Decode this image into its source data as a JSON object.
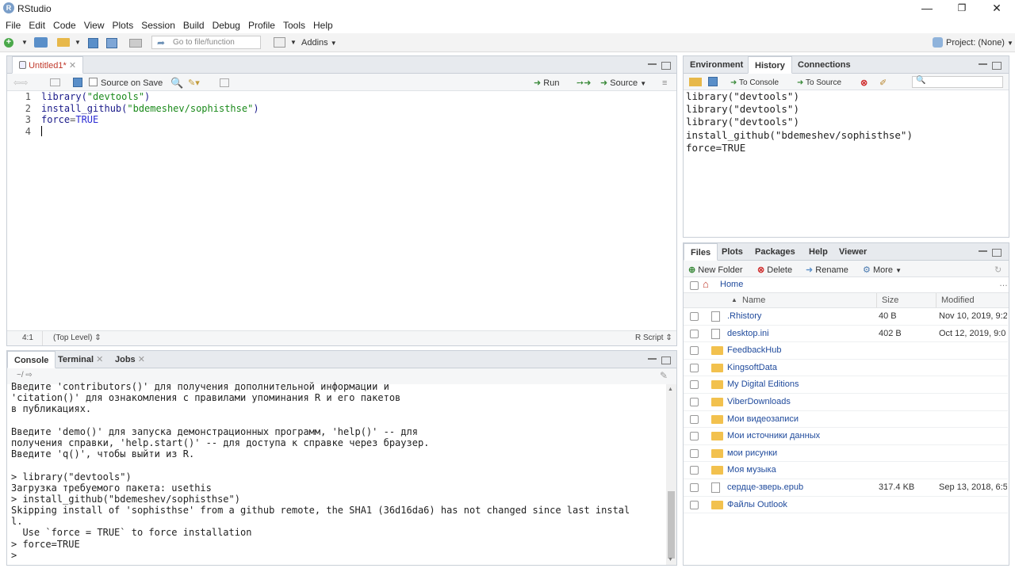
{
  "window": {
    "title": "RStudio",
    "min": "—",
    "max": "❐",
    "close": "✕"
  },
  "menu": [
    "File",
    "Edit",
    "Code",
    "View",
    "Plots",
    "Session",
    "Build",
    "Debug",
    "Profile",
    "Tools",
    "Help"
  ],
  "toolbar": {
    "goto_placeholder": "Go to file/function",
    "addins": "Addins",
    "project": "Project: (None)"
  },
  "editor": {
    "tab": "Untitled1*",
    "source_on_save": "Source on Save",
    "run": "Run",
    "source": "Source",
    "line_numbers": [
      "1",
      "2",
      "3",
      "4"
    ],
    "status_pos": "4:1",
    "status_scope": "(Top Level)",
    "status_type": "R Script"
  },
  "console": {
    "tabs": [
      "Console",
      "Terminal",
      "Jobs"
    ],
    "path": "~/",
    "lines": [
      {
        "t": "Введите 'contributors()' для получения дополнительной информации и",
        "c": "plain"
      },
      {
        "t": "'citation()' для ознакомления с правилами упоминания R и его пакетов",
        "c": "plain"
      },
      {
        "t": "в публикациях.",
        "c": "plain"
      },
      {
        "t": "",
        "c": "plain"
      },
      {
        "t": "Введите 'demo()' для запуска демонстрационных программ, 'help()' -- для",
        "c": "plain"
      },
      {
        "t": "получения справки, 'help.start()' -- для доступа к справке через браузер.",
        "c": "plain"
      },
      {
        "t": "Введите 'q()', чтобы выйти из R.",
        "c": "plain"
      },
      {
        "t": "",
        "c": "plain"
      },
      {
        "t": "> library(\"devtools\")",
        "c": "cmd"
      },
      {
        "t": "Загрузка требуемого пакета: usethis",
        "c": "err"
      },
      {
        "t": "> install_github(\"bdemeshev/sophisthse\")",
        "c": "cmd"
      },
      {
        "t": "Skipping install of 'sophisthse' from a github remote, the SHA1 (36d16da6) has not changed since last instal",
        "c": "err"
      },
      {
        "t": "l.",
        "c": "err"
      },
      {
        "t": "  Use `force = TRUE` to force installation",
        "c": "err"
      },
      {
        "t": "> force=TRUE",
        "c": "cmd"
      },
      {
        "t": "> ",
        "c": "cmd"
      }
    ]
  },
  "env": {
    "tabs": [
      "Environment",
      "History",
      "Connections"
    ],
    "to_console": "To Console",
    "to_source": "To Source",
    "history": [
      "library(\"devtools\")",
      "library(\"devtools\")",
      "library(\"devtools\")",
      "install_github(\"bdemeshev/sophisthse\")",
      "force=TRUE"
    ]
  },
  "files": {
    "tabs": [
      "Files",
      "Plots",
      "Packages",
      "Help",
      "Viewer"
    ],
    "new_folder": "New Folder",
    "delete": "Delete",
    "rename": "Rename",
    "more": "More",
    "home": "Home",
    "col_name": "Name",
    "col_size": "Size",
    "col_modified": "Modified",
    "rows": [
      {
        "name": ".Rhistory",
        "size": "40 B",
        "mod": "Nov 10, 2019, 9:2",
        "icon": "doc"
      },
      {
        "name": "desktop.ini",
        "size": "402 B",
        "mod": "Oct 12, 2019, 9:0",
        "icon": "doc"
      },
      {
        "name": "FeedbackHub",
        "size": "",
        "mod": "",
        "icon": "folder"
      },
      {
        "name": "KingsoftData",
        "size": "",
        "mod": "",
        "icon": "folder"
      },
      {
        "name": "My Digital Editions",
        "size": "",
        "mod": "",
        "icon": "folder"
      },
      {
        "name": "ViberDownloads",
        "size": "",
        "mod": "",
        "icon": "folder"
      },
      {
        "name": "Мои видеозаписи",
        "size": "",
        "mod": "",
        "icon": "folder"
      },
      {
        "name": "Мои источники данных",
        "size": "",
        "mod": "",
        "icon": "folder"
      },
      {
        "name": "мои рисунки",
        "size": "",
        "mod": "",
        "icon": "folder"
      },
      {
        "name": "Моя музыка",
        "size": "",
        "mod": "",
        "icon": "folder"
      },
      {
        "name": "сердце-зверь.epub",
        "size": "317.4 KB",
        "mod": "Sep 13, 2018, 6:5",
        "icon": "doc"
      },
      {
        "name": "Файлы Outlook",
        "size": "",
        "mod": "",
        "icon": "folder"
      }
    ]
  },
  "colors": {
    "pane_border": "#c9cfd7",
    "tab_bg": "#e7eaee",
    "link": "#1f4a9c",
    "error": "#c41a16",
    "command": "#1d3aa6"
  }
}
